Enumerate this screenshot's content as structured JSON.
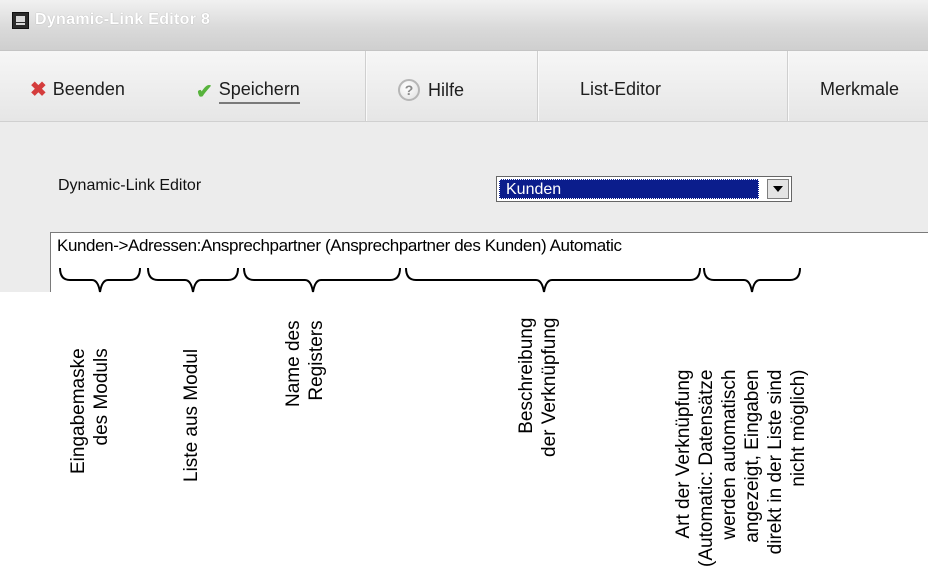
{
  "window": {
    "title": "Dynamic-Link Editor 8"
  },
  "toolbar": {
    "close_label": "Beenden",
    "save_label": "Speichern",
    "help_label": "Hilfe",
    "list_editor_label": "List-Editor",
    "features_label": "Merkmale"
  },
  "form": {
    "label": "Dynamic-Link Editor",
    "select_value": "Kunden",
    "link_text": "Kunden->Adressen:Ansprechpartner (Ansprechpartner des Kunden) Automatic"
  },
  "annotations": [
    {
      "lines": [
        "Eingabemaske",
        "des Moduls"
      ]
    },
    {
      "lines": [
        "Liste aus Modul"
      ]
    },
    {
      "lines": [
        "Name des",
        "Registers"
      ]
    },
    {
      "lines": [
        "Beschreibung",
        "der Verknüpfung"
      ]
    },
    {
      "lines": [
        "Art der Verknüpfung",
        "(Automatic: Datensätze",
        "werden automatisch",
        "angezeigt, Eingaben",
        "direkt in der Liste sind",
        "nicht möglich)"
      ]
    }
  ]
}
